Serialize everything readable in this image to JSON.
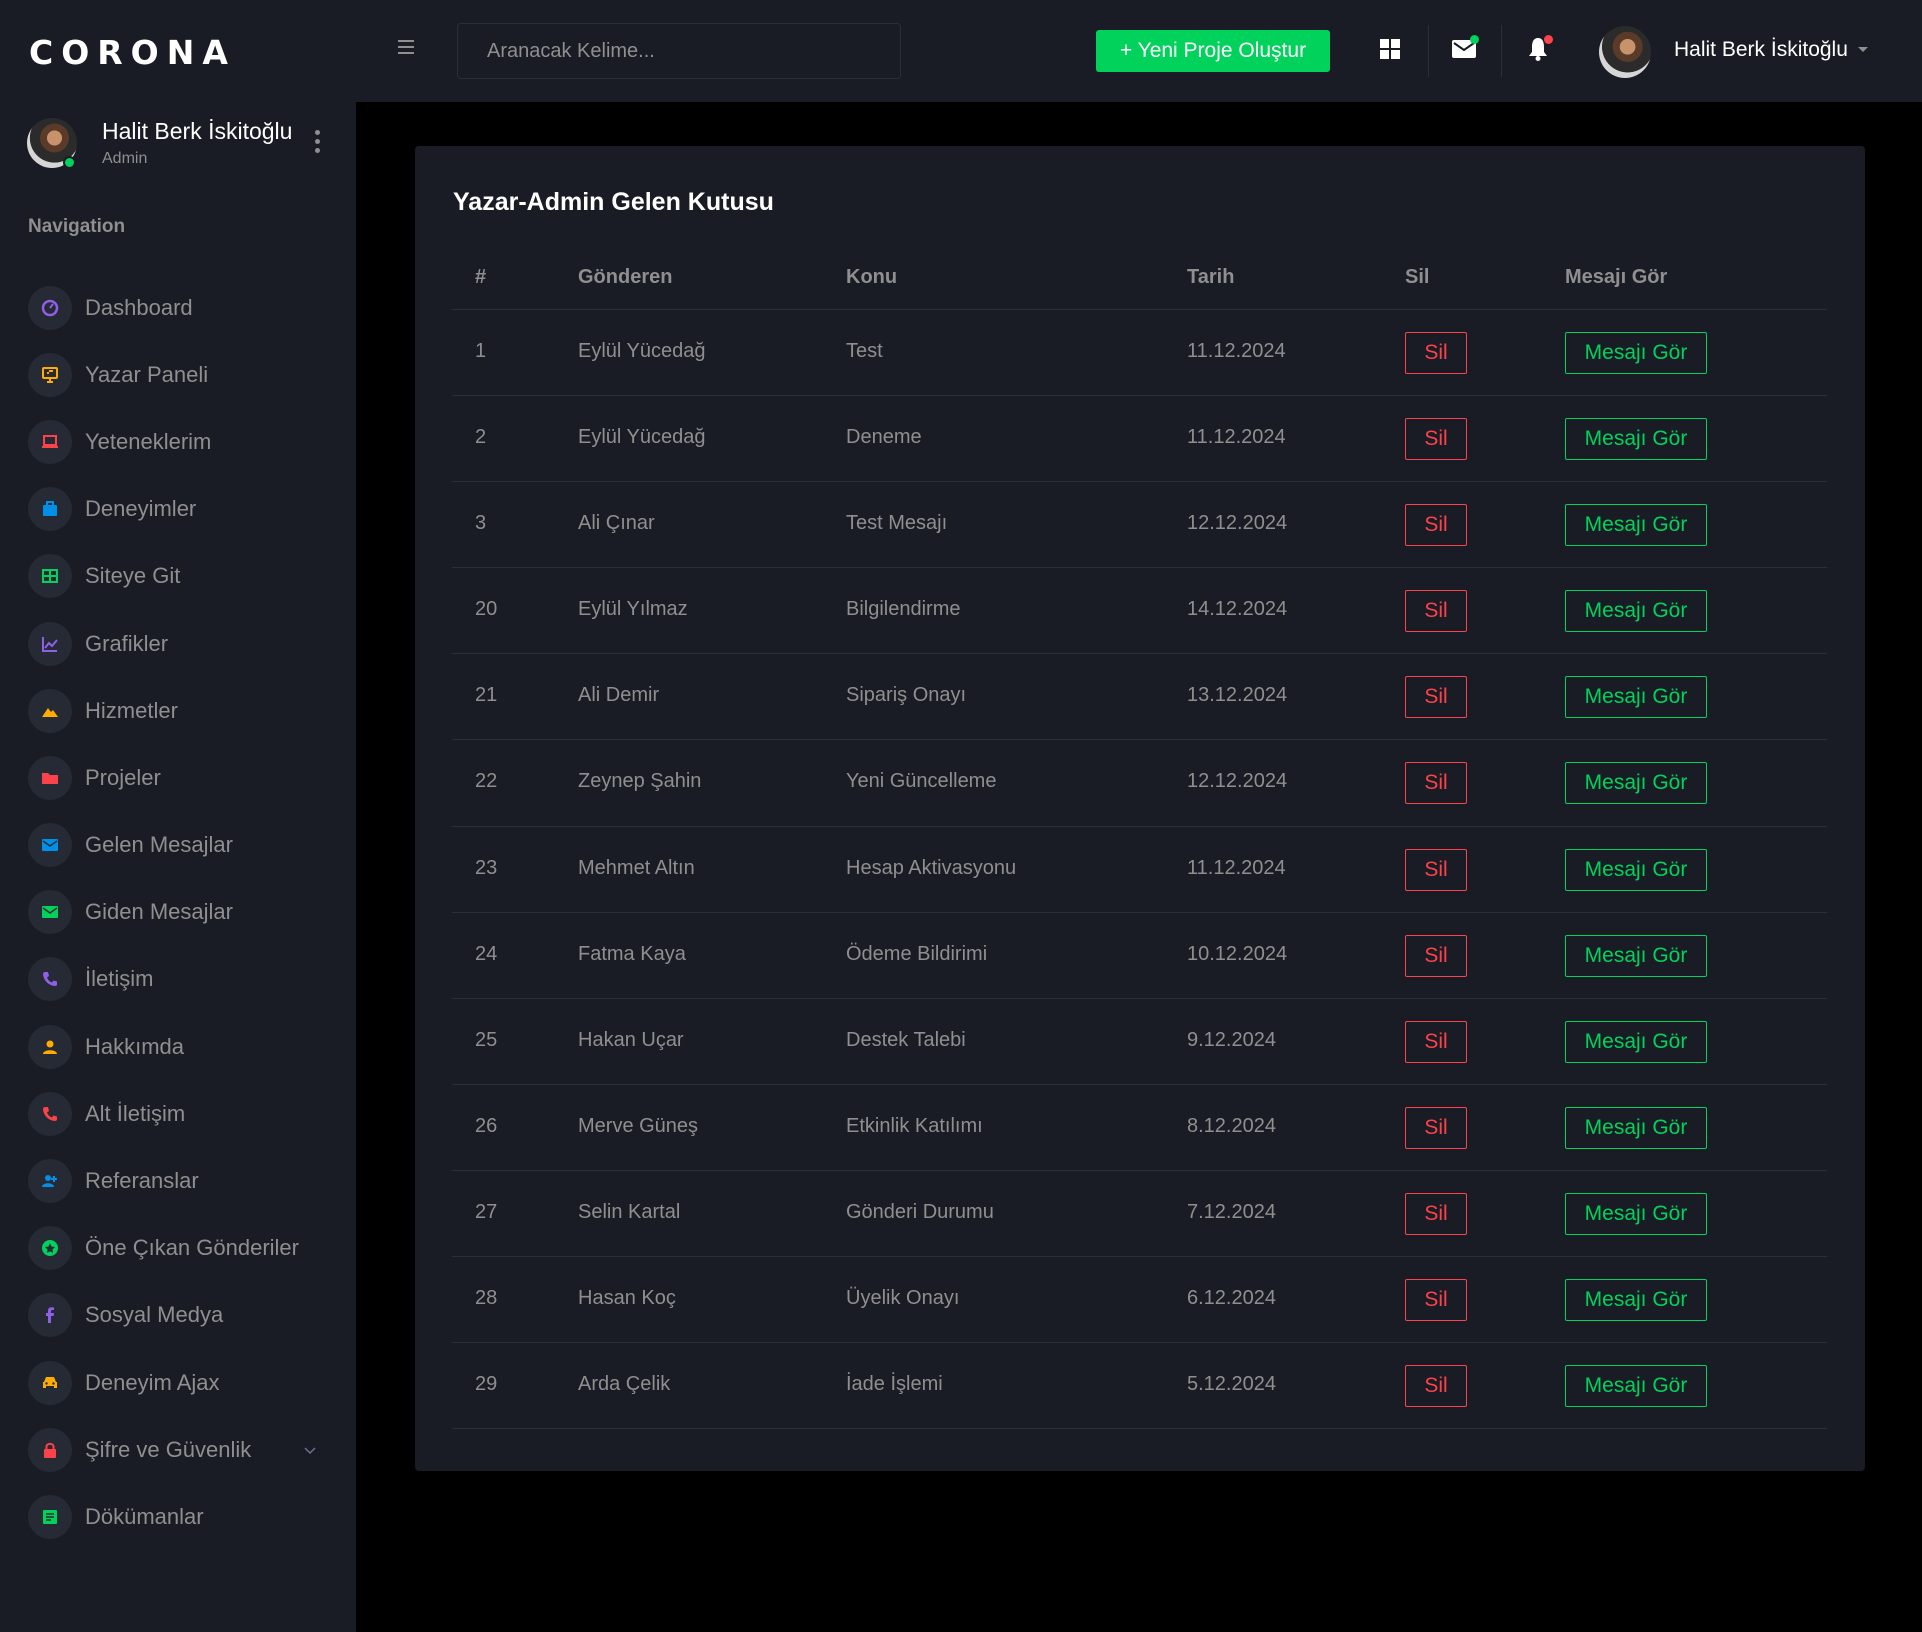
{
  "brand": "CORONA",
  "colors": {
    "sidebar_bg": "#191c24",
    "page_bg": "#000000",
    "success": "#00d25b",
    "danger": "#fc424a",
    "muted": "#8f8f8f"
  },
  "profile": {
    "name": "Halit Berk İskitoğlu",
    "role": "Admin"
  },
  "navigation": {
    "title": "Navigation",
    "items": [
      {
        "label": "Dashboard",
        "icon": "speedometer-icon",
        "color": "#8f5fe8"
      },
      {
        "label": "Yazar Paneli",
        "icon": "presentation-icon",
        "color": "#ffab00"
      },
      {
        "label": "Yeteneklerim",
        "icon": "laptop-icon",
        "color": "#fc424a"
      },
      {
        "label": "Deneyimler",
        "icon": "briefcase-icon",
        "color": "#0090e7"
      },
      {
        "label": "Siteye Git",
        "icon": "table-icon",
        "color": "#00d25b"
      },
      {
        "label": "Grafikler",
        "icon": "chart-line-icon",
        "color": "#8f5fe8"
      },
      {
        "label": "Hizmetler",
        "icon": "terrain-icon",
        "color": "#ffab00"
      },
      {
        "label": "Projeler",
        "icon": "folder-icon",
        "color": "#fc424a"
      },
      {
        "label": "Gelen Mesajlar",
        "icon": "mail-icon",
        "color": "#0090e7"
      },
      {
        "label": "Giden Mesajlar",
        "icon": "mail-sent-icon",
        "color": "#00d25b"
      },
      {
        "label": "İletişim",
        "icon": "phone-icon",
        "color": "#8f5fe8"
      },
      {
        "label": "Hakkımda",
        "icon": "user-icon",
        "color": "#ffab00"
      },
      {
        "label": "Alt İletişim",
        "icon": "phone-icon",
        "color": "#fc424a"
      },
      {
        "label": "Referanslar",
        "icon": "account-group-icon",
        "color": "#0090e7"
      },
      {
        "label": "Öne Çıkan Gönderiler",
        "icon": "star-circle-icon",
        "color": "#00d25b"
      },
      {
        "label": "Sosyal Medya",
        "icon": "facebook-icon",
        "color": "#8f5fe8"
      },
      {
        "label": "Deneyim Ajax",
        "icon": "car-icon",
        "color": "#ffab00"
      },
      {
        "label": "Şifre ve Güvenlik",
        "icon": "lock-icon",
        "color": "#fc424a",
        "has_submenu": true
      },
      {
        "label": "Dökümanlar",
        "icon": "document-icon",
        "color": "#00d25b"
      }
    ]
  },
  "topbar": {
    "search_placeholder": "Aranacak Kelime...",
    "new_project_label": "+ Yeni Proje Oluştur",
    "user_name": "Halit Berk İskitoğlu"
  },
  "inbox": {
    "title": "Yazar-Admin Gelen Kutusu",
    "columns": [
      "#",
      "Gönderen",
      "Konu",
      "Tarih",
      "Sil",
      "Mesajı Gör"
    ],
    "delete_label": "Sil",
    "view_label": "Mesajı Gör",
    "rows": [
      {
        "id": "1",
        "sender": "Eylül Yücedağ",
        "subject": "Test",
        "date": "11.12.2024"
      },
      {
        "id": "2",
        "sender": "Eylül Yücedağ",
        "subject": "Deneme",
        "date": "11.12.2024"
      },
      {
        "id": "3",
        "sender": "Ali Çınar",
        "subject": "Test Mesajı",
        "date": "12.12.2024"
      },
      {
        "id": "20",
        "sender": "Eylül Yılmaz",
        "subject": "Bilgilendirme",
        "date": "14.12.2024"
      },
      {
        "id": "21",
        "sender": "Ali Demir",
        "subject": "Sipariş Onayı",
        "date": "13.12.2024"
      },
      {
        "id": "22",
        "sender": "Zeynep Şahin",
        "subject": "Yeni Güncelleme",
        "date": "12.12.2024"
      },
      {
        "id": "23",
        "sender": "Mehmet Altın",
        "subject": "Hesap Aktivasyonu",
        "date": "11.12.2024"
      },
      {
        "id": "24",
        "sender": "Fatma Kaya",
        "subject": "Ödeme Bildirimi",
        "date": "10.12.2024"
      },
      {
        "id": "25",
        "sender": "Hakan Uçar",
        "subject": "Destek Talebi",
        "date": "9.12.2024"
      },
      {
        "id": "26",
        "sender": "Merve Güneş",
        "subject": "Etkinlik Katılımı",
        "date": "8.12.2024"
      },
      {
        "id": "27",
        "sender": "Selin Kartal",
        "subject": "Gönderi Durumu",
        "date": "7.12.2024"
      },
      {
        "id": "28",
        "sender": "Hasan Koç",
        "subject": "Üyelik Onayı",
        "date": "6.12.2024"
      },
      {
        "id": "29",
        "sender": "Arda Çelik",
        "subject": "İade İşlemi",
        "date": "5.12.2024"
      }
    ]
  }
}
